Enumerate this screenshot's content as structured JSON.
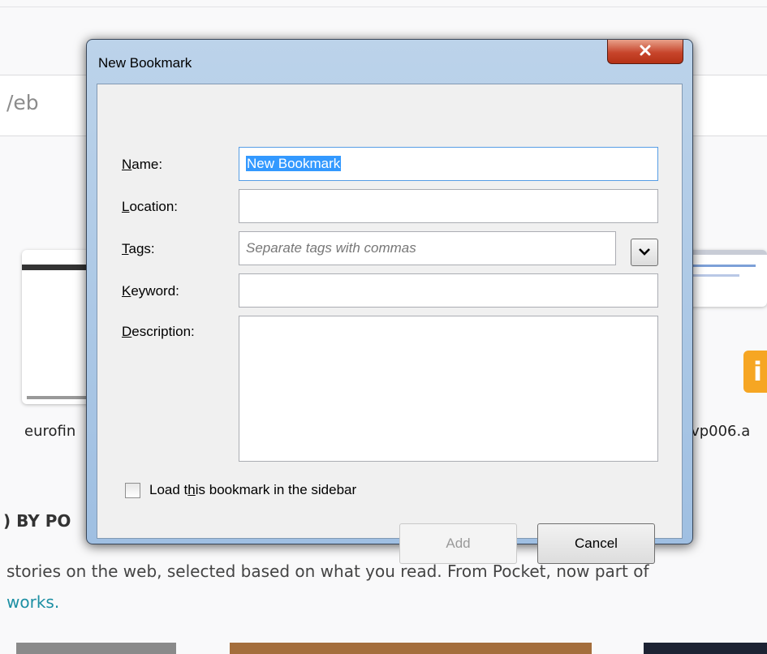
{
  "background": {
    "search_text": "/eb",
    "tile_left_label": "eurofin",
    "tile_right_label": "evp006.a",
    "section_heading": ") BY PO",
    "pocket_text": "stories on the web, selected based on what you read. From Pocket, now part of",
    "pocket_link": "works.",
    "orange_icon_glyph": "i"
  },
  "dialog": {
    "title": "New Bookmark",
    "fields": {
      "name": {
        "label_key": "N",
        "label_rest": "ame:",
        "value": "New Bookmark"
      },
      "location": {
        "label_key": "L",
        "label_rest": "ocation:",
        "value": ""
      },
      "tags": {
        "label_key": "T",
        "label_rest": "ags:",
        "placeholder": "Separate tags with commas"
      },
      "keyword": {
        "label_key": "K",
        "label_rest": "eyword:",
        "value": ""
      },
      "description": {
        "label_key": "D",
        "label_rest": "escription:",
        "value": ""
      }
    },
    "sidebar_checkbox": {
      "label_pre": "Load t",
      "label_key": "h",
      "label_post": "is bookmark in the sidebar",
      "checked": false
    },
    "buttons": {
      "add": "Add",
      "cancel": "Cancel"
    },
    "colors": {
      "selection": "#3399ff",
      "close_button": "#c7452b",
      "frame": "#9fbfe2"
    }
  }
}
